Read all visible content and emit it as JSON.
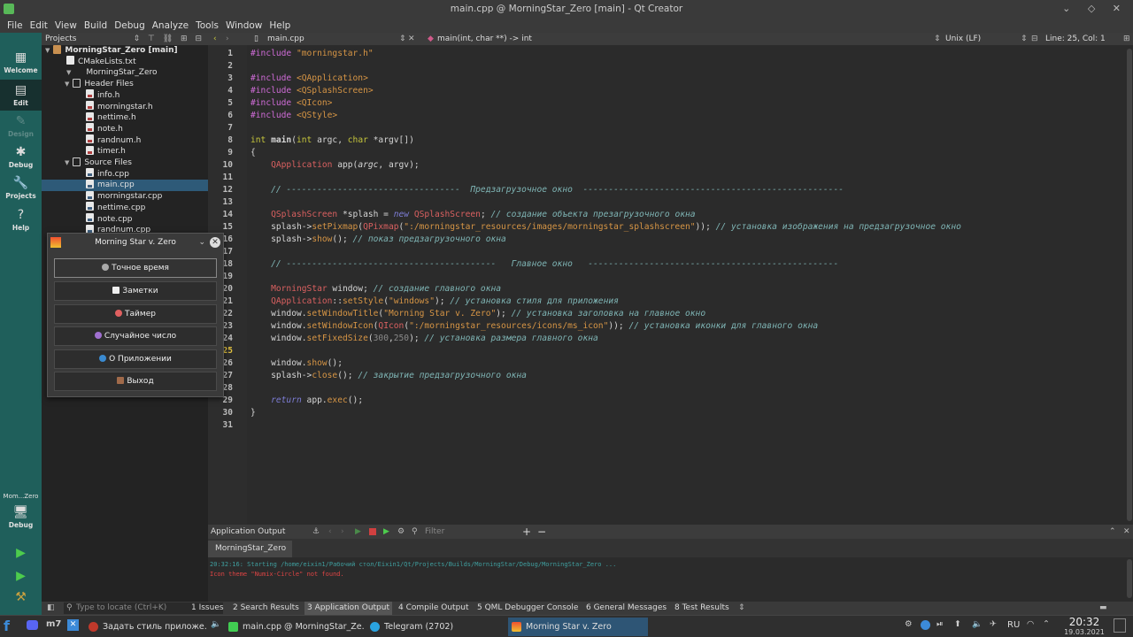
{
  "window": {
    "title": "main.cpp @ MorningStar_Zero [main] - Qt Creator",
    "controls": "⌄ ◇ ✕"
  },
  "menu": [
    "File",
    "Edit",
    "View",
    "Build",
    "Debug",
    "Analyze",
    "Tools",
    "Window",
    "Help"
  ],
  "modes": [
    {
      "label": "Welcome",
      "icon": "grid-icon"
    },
    {
      "label": "Edit",
      "icon": "edit-icon"
    },
    {
      "label": "Design",
      "icon": "pen-icon"
    },
    {
      "label": "Debug",
      "icon": "bug-icon"
    },
    {
      "label": "Projects",
      "icon": "wrench-icon"
    },
    {
      "label": "Help",
      "icon": "help-icon"
    }
  ],
  "kit": {
    "name": "Mom...Zero",
    "config": "Debug"
  },
  "projects": {
    "header": "Projects",
    "tree": [
      {
        "text": "MorningStar_Zero [main]",
        "level": 0,
        "kind": "project"
      },
      {
        "text": "CMakeLists.txt",
        "level": 1,
        "kind": "file"
      },
      {
        "text": "MorningStar_Zero",
        "level": 1,
        "kind": "target"
      },
      {
        "text": "Header Files",
        "level": 2,
        "kind": "folder"
      },
      {
        "text": "info.h",
        "level": 3,
        "kind": "h"
      },
      {
        "text": "morningstar.h",
        "level": 3,
        "kind": "h"
      },
      {
        "text": "nettime.h",
        "level": 3,
        "kind": "h"
      },
      {
        "text": "note.h",
        "level": 3,
        "kind": "h"
      },
      {
        "text": "randnum.h",
        "level": 3,
        "kind": "h"
      },
      {
        "text": "timer.h",
        "level": 3,
        "kind": "h"
      },
      {
        "text": "Source Files",
        "level": 2,
        "kind": "folder"
      },
      {
        "text": "info.cpp",
        "level": 3,
        "kind": "c"
      },
      {
        "text": "main.cpp",
        "level": 3,
        "kind": "c",
        "selected": true
      },
      {
        "text": "morningstar.cpp",
        "level": 3,
        "kind": "c"
      },
      {
        "text": "nettime.cpp",
        "level": 3,
        "kind": "c"
      },
      {
        "text": "note.cpp",
        "level": 3,
        "kind": "c"
      },
      {
        "text": "randnum.cpp",
        "level": 3,
        "kind": "c"
      }
    ]
  },
  "editor": {
    "file": "main.cpp",
    "symbol": "main(int, char **) -> int",
    "encoding": "Unix (LF)",
    "position": "Line: 25, Col: 1"
  },
  "code_lines": [
    "1",
    "2",
    "3",
    "4",
    "5",
    "6",
    "7",
    "8",
    "9",
    "10",
    "11",
    "12",
    "13",
    "14",
    "15",
    "16",
    "17",
    "18",
    "19",
    "20",
    "21",
    "22",
    "23",
    "24",
    "25",
    "26",
    "27",
    "28",
    "29",
    "30",
    "31"
  ],
  "output": {
    "pane_title": "Application Output",
    "filter_placeholder": "Filter",
    "tab": "MorningStar_Zero",
    "line1": "20:32:16: Starting /home/eixin1/Рабочий стол/Eixin1/Qt/Projects/Builds/MorningStar/Debug/MorningStar_Zero ...",
    "line2": "Icon theme \"Numix-Circle\" not found."
  },
  "status": {
    "locator_placeholder": "Type to locate (Ctrl+K)",
    "tabs": [
      "1  Issues",
      "2  Search Results",
      "3  Application Output",
      "4  Compile Output",
      "5  QML Debugger Console",
      "6  General Messages",
      "8  Test Results"
    ]
  },
  "popup": {
    "title": "Morning Star v. Zero",
    "buttons": [
      "Точное время",
      "Заметки",
      "Таймер",
      "Случайное число",
      "О Приложении",
      "Выход"
    ]
  },
  "taskbar": {
    "items": [
      {
        "label": "Задать стиль приложе...",
        "color": "#c0392b"
      },
      {
        "label": "main.cpp @ MorningStar_Ze...",
        "color": "#41cd52"
      },
      {
        "label": "Telegram (2702)",
        "color": "#2aa3e0"
      },
      {
        "label": "Morning Star v. Zero",
        "color": "#f0a030"
      }
    ],
    "tray_lang": "RU",
    "time": "20:32",
    "date": "19.03.2021"
  }
}
